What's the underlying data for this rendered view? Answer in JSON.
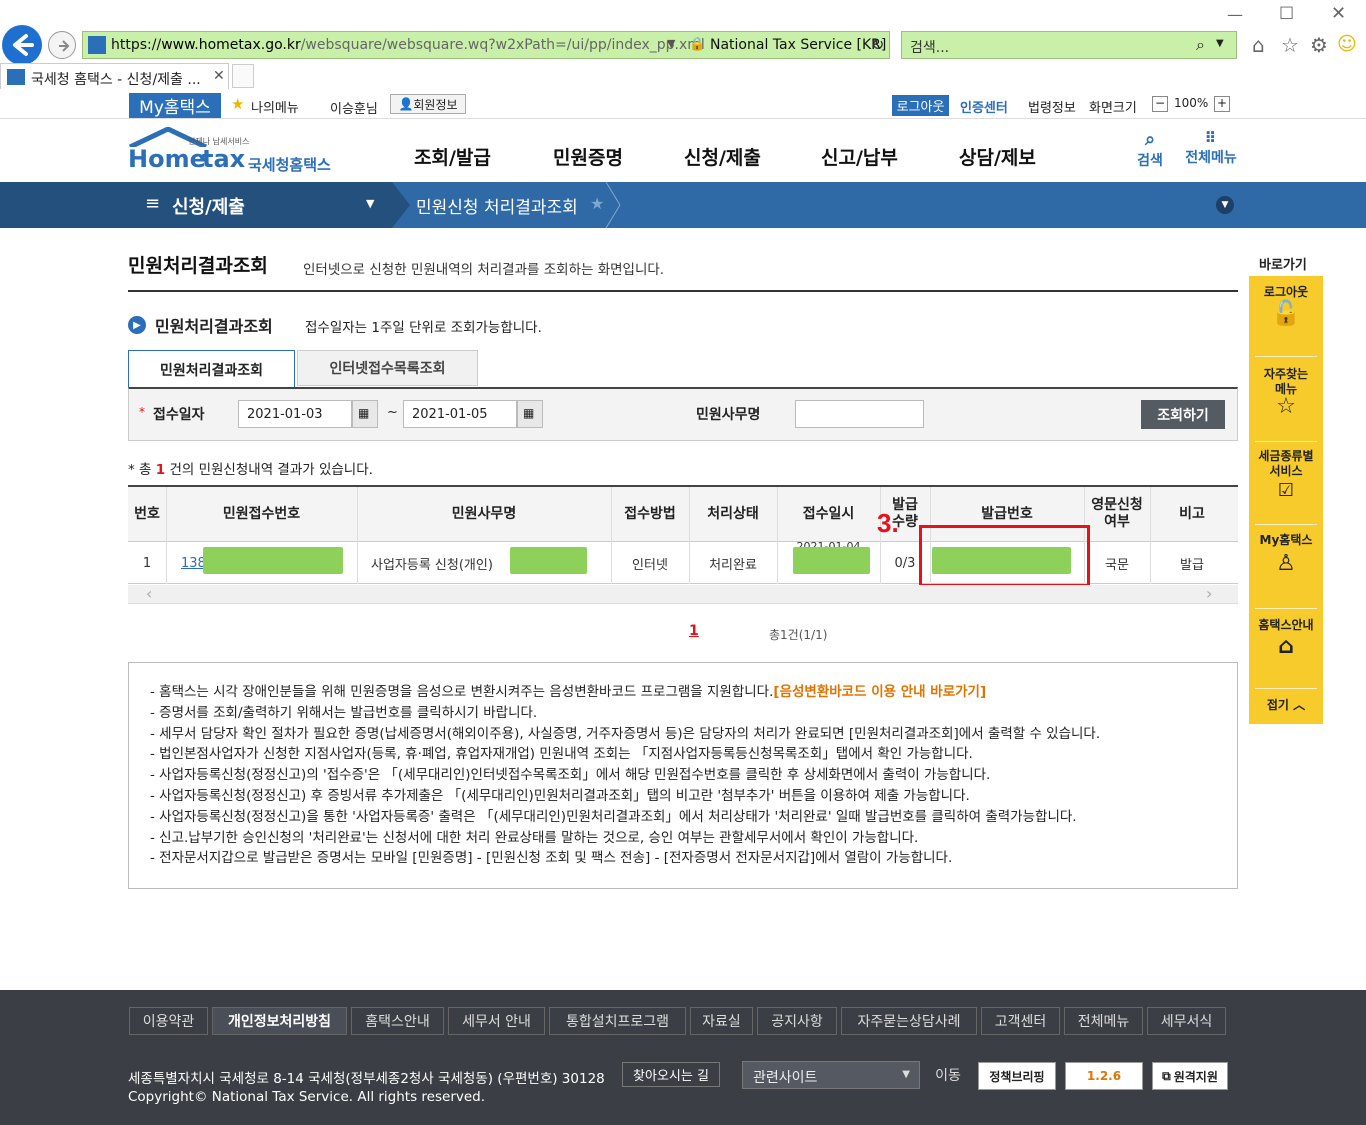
{
  "browser": {
    "url_prefix": "https://",
    "url_domain": "www.hometax.go.kr",
    "url_path": "/websquare/websquare.wq?w2xPath=/ui/pp/index_pp.xml",
    "site_identity": "National Tax Service [KR]",
    "search_placeholder": "검색...",
    "tab_title": "국세청 홈택스 - 신청/제출 ..."
  },
  "util_bar": {
    "my_hometax": "My홈택스",
    "my_menu": "나의메뉴",
    "user_name": "이승훈님",
    "member_info": "회원정보",
    "logout": "로그아웃",
    "cert_center": "인증센터",
    "law_info": "법령정보",
    "screen_size": "화면크기",
    "zoom": "100%"
  },
  "gnb": {
    "logo_small": "언제나 납세서비스",
    "logo_text_1": "Home",
    "logo_text_2": "tax",
    "logo_sub": "국세청홈택스",
    "menus": [
      "조회/발급",
      "민원증명",
      "신청/제출",
      "신고/납부",
      "상담/제보"
    ],
    "search": "검색",
    "all_menu": "전체메뉴"
  },
  "location": {
    "section": "신청/제출",
    "current": "민원신청 처리결과조회"
  },
  "page": {
    "title": "민원처리결과조회",
    "desc": "인터넷으로 신청한 민원내역의 처리결과를 조회하는 화면입니다.",
    "sub_title": "민원처리결과조회",
    "sub_desc": "접수일자는 1주일 단위로 조회가능합니다.",
    "tabs": [
      "민원처리결과조회",
      "인터넷접수목록조회"
    ]
  },
  "search": {
    "date_label": "접수일자",
    "date_from": "2021-01-03",
    "tilde": "~",
    "date_to": "2021-01-05",
    "name_label": "민원사무명",
    "name_value": "",
    "submit": "조회하기"
  },
  "result": {
    "prefix": "* 총 ",
    "count": "1",
    "suffix": " 건의 민원신청내역 결과가 있습니다."
  },
  "table": {
    "headers": [
      "번호",
      "민원접수번호",
      "민원사무명",
      "접수방법",
      "처리상태",
      "접수일시",
      "발급\n수량",
      "발급번호",
      "영문신청\n여부",
      "비고"
    ],
    "row": {
      "no": "1",
      "receipt_prefix": "138",
      "name_prefix": "사업자등록 신청(개인)",
      "method": "인터넷",
      "status": "처리완료",
      "datetime_partial": "2021-01-04",
      "qty": "0/3",
      "lang": "국문",
      "note": "발급"
    },
    "annotation": "3.",
    "annotation_color": "#e8101a"
  },
  "pagination": {
    "current": "1",
    "summary": "총1건(1/1)"
  },
  "notices": [
    {
      "text": "- 홈택스는 시각 장애인분들을 위해 민원증명을 음성으로 변환시켜주는 음성변환바코드 프로그램을 지원합니다.",
      "link": "[음성변환바코드 이용 안내 바로가기]"
    },
    {
      "text": "- 증명서를 조회/출력하기 위해서는 발급번호를 클릭하시기 바랍니다."
    },
    {
      "text": "- 세무서 담당자 확인 절차가 필요한 증명(납세증명서(해외이주용), 사실증명, 거주자증명서 등)은 담당자의 처리가 완료되면 [민원처리결과조회]에서 출력할 수 있습니다."
    },
    {
      "text": "- 법인본점사업자가 신청한 지점사업자(등록, 휴·폐업, 휴업자재개업) 민원내역 조회는 「지점사업자등록등신청목록조회」탭에서 확인 가능합니다."
    },
    {
      "text": "- 사업자등록신청(정정신고)의 '접수증'은 「(세무대리인)인터넷접수목록조회」에서 해당 민원접수번호를 클릭한 후 상세화면에서 출력이 가능합니다."
    },
    {
      "text": "- 사업자등록신청(정정신고) 후 증빙서류 추가제출은 「(세무대리인)민원처리결과조회」탭의 비고란 '첨부추가' 버튼을 이용하여 제출 가능합니다."
    },
    {
      "text": "- 사업자등록신청(정정신고)을 통한 '사업자등록증' 출력은  「(세무대리인)민원처리결과조회」에서 처리상태가 '처리완료' 일때 발급번호를 클릭하여 출력가능합니다."
    },
    {
      "text": "- 신고.납부기한 승인신청의 '처리완료'는 신청서에 대한 처리 완료상태를 말하는 것으로, 승인 여부는 관할세무서에서 확인이 가능합니다."
    },
    {
      "text": "- 전자문서지갑으로 발급받은 증명서는 모바일 [민원증명] - [민원신청 조회 및 팩스 전송] - [전자증명서 전자문서지갑]에서 열람이 가능합니다."
    }
  ],
  "quick_menu": {
    "title": "바로가기",
    "items": [
      "로그아웃",
      "자주찾는\n메뉴",
      "세금종류별\n서비스",
      "My홈택스",
      "홈택스안내"
    ],
    "collapse": "접기"
  },
  "footer": {
    "links": [
      "이용약관",
      "개인정보처리방침",
      "홈택스안내",
      "세무서 안내",
      "통합설치프로그램",
      "자료실",
      "공지사항",
      "자주묻는상담사례",
      "고객센터",
      "전체메뉴",
      "세무서식"
    ],
    "address": "세종특별자치시 국세청로 8-14 국세청(정부세종2청사 국세청동) (우편번호) 30128",
    "directions": "찾아오시는 길",
    "copyright": "Copyright© National Tax Service. All rights reserved.",
    "related_select": "관련사이트",
    "go": "이동",
    "badge_1": "정책브리핑",
    "badge_2": "1.2.6",
    "remote": "원격지원"
  }
}
